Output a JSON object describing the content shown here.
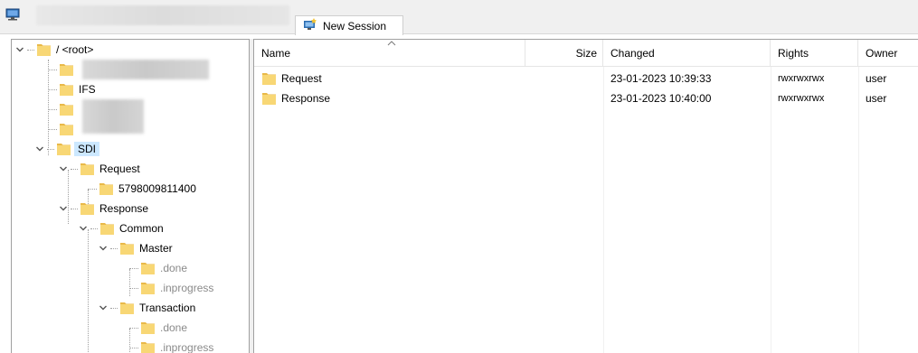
{
  "toolbar": {
    "new_session_label": "New Session"
  },
  "tree": {
    "root_label": "/ <root>",
    "ifs_label": "IFS",
    "sdi_label": "SDI",
    "request_label": "Request",
    "request_child_label": "5798009811400",
    "response_label": "Response",
    "common_label": "Common",
    "master_label": "Master",
    "master_done_label": ".done",
    "master_inprogress_label": ".inprogress",
    "transaction_label": "Transaction",
    "transaction_done_label": ".done",
    "transaction_inprogress_label": ".inprogress"
  },
  "list": {
    "columns": {
      "name": "Name",
      "size": "Size",
      "changed": "Changed",
      "rights": "Rights",
      "owner": "Owner"
    },
    "rows": [
      {
        "name": "Request",
        "size": "",
        "changed": "23-01-2023 10:39:33",
        "rights": "rwxrwxrwx",
        "owner": "user"
      },
      {
        "name": "Response",
        "size": "",
        "changed": "23-01-2023 10:40:00",
        "rights": "rwxrwxrwx",
        "owner": "user"
      }
    ]
  },
  "colors": {
    "folder": "#f8d775",
    "selection": "#cce8ff",
    "border": "#a0a0a0"
  },
  "icons": {
    "app": "computer-icon",
    "session": "new-session-icon",
    "folder": "folder-icon",
    "expand": "chevron-down-icon"
  }
}
